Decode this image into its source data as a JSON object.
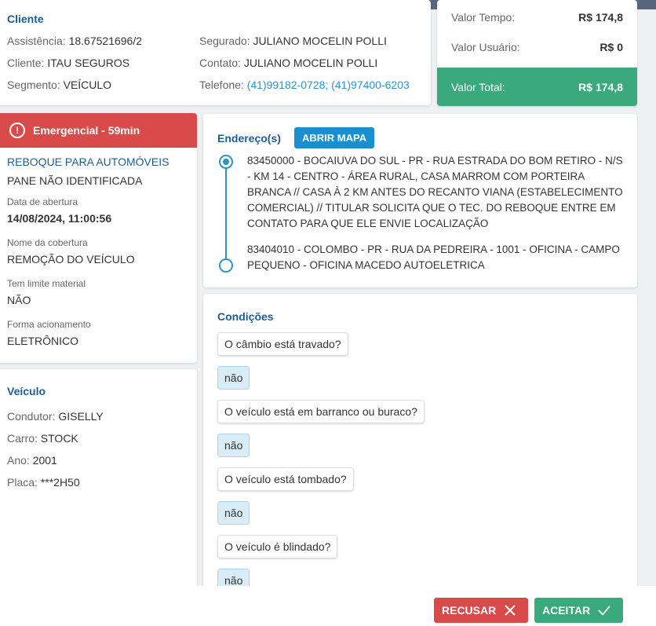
{
  "cliente": {
    "title": "Cliente",
    "assistencia_label": "Assistência:",
    "assistencia_value": "18.67521696/2",
    "cliente_label": "Cliente:",
    "cliente_value": "ITAU SEGUROS",
    "segmento_label": "Segmento:",
    "segmento_value": "VEÍCULO",
    "segurado_label": "Segurado:",
    "segurado_value": "JULIANO MOCELIN POLLI",
    "contato_label": "Contato:",
    "contato_value": "JULIANO MOCELIN POLLI",
    "telefone_label": "Telefone:",
    "telefone_value": "(41)99182-0728; (41)97400-6203"
  },
  "valores": {
    "tempo_label": "Valor Tempo:",
    "tempo_value": "R$ 174,8",
    "usuario_label": "Valor Usuário:",
    "usuario_value": "R$ 0",
    "total_label": "Valor Total:",
    "total_value": "R$ 174,8"
  },
  "emergencia": {
    "icon": "alert-circle-icon",
    "label": "Emergencial - 59min",
    "color": "#d94a4a"
  },
  "servico": {
    "tipo": "REBOQUE PARA AUTOMÓVEIS",
    "problema": "PANE NÃO IDENTIFICADA",
    "data_label": "Data de abertura",
    "data_value": "14/08/2024, 11:00:56",
    "cobertura_label": "Nome da cobertura",
    "cobertura_value": "REMOÇÃO DO VEÍCULO",
    "limite_label": "Tem limite material",
    "limite_value": "NÃO",
    "forma_label": "Forma acionamento",
    "forma_value": "ELETRÔNICO"
  },
  "veiculo": {
    "title": "Veículo",
    "condutor_label": "Condutor:",
    "condutor_value": "GISELLY",
    "carro_label": "Carro:",
    "carro_value": "STOCK",
    "ano_label": "Ano:",
    "ano_value": "2001",
    "placa_label": "Placa:",
    "placa_value": "***2H50"
  },
  "endereco": {
    "title": "Endereço(s)",
    "map_button": "ABRIR MAPA",
    "origem": "83450000 - BOCAIUVA DO SUL - PR - RUA ESTRADA DO BOM RETIRO - N/S - KM 14 - CENTRO - ÁREA RURAL, CASA MARROM COM PORTEIRA BRANCA // CASA À 2 KM ANTES DO RECANTO VIANA (ESTABELECIMENTO COMERCIAL) // TITULAR SOLICITA QUE O TEC. DO REBOQUE ENTRE EM CONTATO PARA QUE ELE ENVIE LOCALIZAÇÃO",
    "destino": "83404010 - COLOMBO - PR - RUA DA PEDREIRA - 1001 - OFICINA - CAMPO PEQUENO - OFICINA MACEDO AUTOELETRICA"
  },
  "condicoes": {
    "title": "Condições",
    "items": [
      {
        "pergunta": "O câmbio está travado?",
        "resposta": "não"
      },
      {
        "pergunta": "O veículo está em barranco ou buraco?",
        "resposta": "não"
      },
      {
        "pergunta": "O veículo está tombado?",
        "resposta": "não"
      },
      {
        "pergunta": "O veículo é blindado?",
        "resposta": "não"
      }
    ]
  },
  "acoes": {
    "recusar": "RECUSAR",
    "aceitar": "ACEITAR",
    "recusar_icon": "close-icon",
    "aceitar_icon": "check-icon"
  },
  "colors": {
    "accent_blue": "#1b5e96",
    "link_blue": "#2b94c9",
    "green": "#3aaa7c",
    "red": "#d94a4a"
  }
}
